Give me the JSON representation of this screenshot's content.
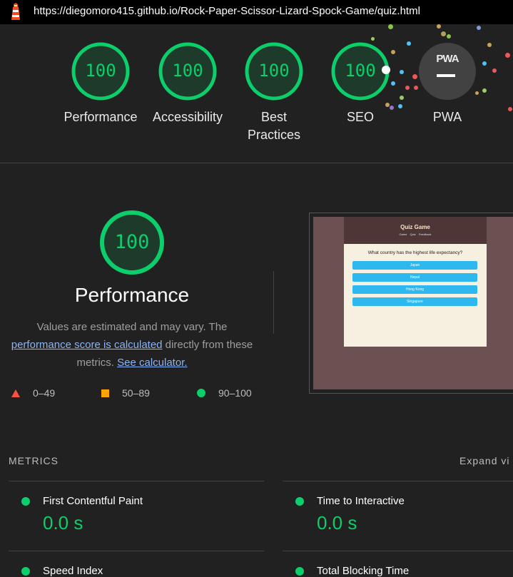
{
  "url": "https://diegomoro415.github.io/Rock-Paper-Scissor-Lizard-Spock-Game/quiz.html",
  "gauges": [
    {
      "score": "100",
      "label": "Performance"
    },
    {
      "score": "100",
      "label": "Accessibility"
    },
    {
      "score": "100",
      "label": "Best Practices"
    },
    {
      "score": "100",
      "label": "SEO"
    }
  ],
  "pwa": {
    "badge": "PWA",
    "label": "PWA"
  },
  "performance": {
    "score": "100",
    "title": "Performance",
    "desc_before": "Values are estimated and may vary. The ",
    "desc_link": "performance score is calculated",
    "desc_middle": " directly from these metrics. ",
    "desc_link2": "See calculator."
  },
  "legend": [
    {
      "range": "0–49",
      "color": "#ff4e42"
    },
    {
      "range": "50–89",
      "color": "#ffa400"
    },
    {
      "range": "90–100",
      "color": "#0cce6b"
    }
  ],
  "screenshot": {
    "brand": "Quiz Game",
    "nav": "Game Quiz Feedback",
    "question": "What country has the highest life expectancy?",
    "answers": [
      "Japan",
      "Nepal",
      "Hong Kong",
      "Singapure"
    ]
  },
  "metrics": {
    "heading": "METRICS",
    "expand": "Expand vi",
    "items": [
      {
        "name": "First Contentful Paint",
        "value": "0.0 s"
      },
      {
        "name": "Time to Interactive",
        "value": "0.0 s"
      },
      {
        "name": "Speed Index",
        "value": ""
      },
      {
        "name": "Total Blocking Time",
        "value": ""
      }
    ]
  },
  "colors": {
    "pass": "#0cce6b",
    "average": "#ffa400",
    "fail": "#ff4e42",
    "link": "#8ab4f8"
  }
}
